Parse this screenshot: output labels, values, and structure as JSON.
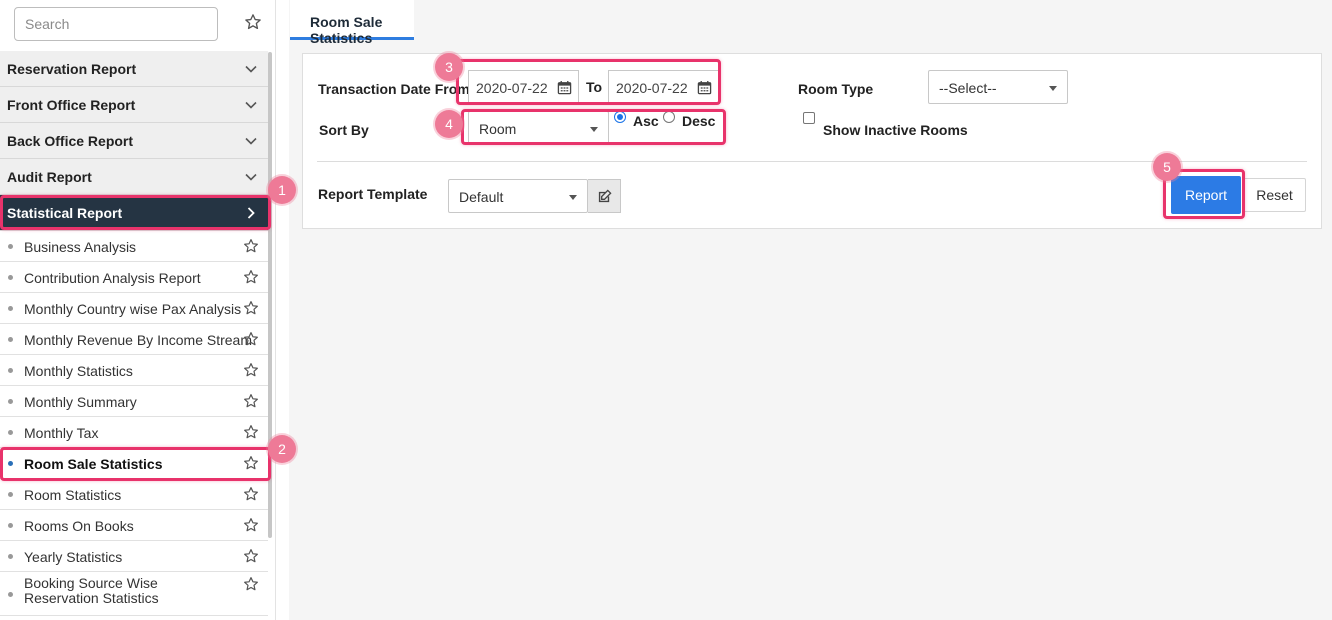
{
  "sidebar": {
    "search": {
      "placeholder": "Search",
      "value": ""
    },
    "categories": [
      {
        "label": "Reservation Report"
      },
      {
        "label": "Front Office Report"
      },
      {
        "label": "Back Office Report"
      },
      {
        "label": "Audit Report"
      },
      {
        "label": "Statistical Report",
        "active": true
      }
    ],
    "items": [
      {
        "label": "Business Analysis"
      },
      {
        "label": "Contribution Analysis Report"
      },
      {
        "label": "Monthly Country wise Pax Analysis"
      },
      {
        "label": "Monthly Revenue By Income Stream"
      },
      {
        "label": "Monthly Statistics"
      },
      {
        "label": "Monthly Summary"
      },
      {
        "label": "Monthly Tax"
      },
      {
        "label": "Room Sale Statistics",
        "active": true
      },
      {
        "label": "Room Statistics"
      },
      {
        "label": "Rooms On Books"
      },
      {
        "label": "Yearly Statistics"
      },
      {
        "label": "Booking Source Wise Reservation Statistics"
      }
    ]
  },
  "tab": {
    "label": "Room Sale Statistics"
  },
  "form": {
    "transaction_date_label": "Transaction Date From",
    "date_from": "2020-07-22",
    "to_label": "To",
    "date_to": "2020-07-22",
    "room_type_label": "Room Type",
    "room_type_value": "--Select--",
    "sort_by_label": "Sort By",
    "sort_by_value": "Room",
    "asc_label": "Asc",
    "desc_label": "Desc",
    "sort_order": "Asc",
    "show_inactive_label": "Show Inactive Rooms",
    "show_inactive_checked": false,
    "report_template_label": "Report Template",
    "report_template_value": "Default",
    "report_button": "Report",
    "reset_button": "Reset"
  },
  "annotations": {
    "badge_1": "1",
    "badge_2": "2",
    "badge_3": "3",
    "badge_4": "4",
    "badge_5": "5",
    "highlight_color": "#e8336b",
    "badge_color": "#ee7a97"
  },
  "colors": {
    "sidebar_active_bg": "#253443",
    "tab_accent": "#2f7de0",
    "primary_button": "#2c7be5"
  }
}
